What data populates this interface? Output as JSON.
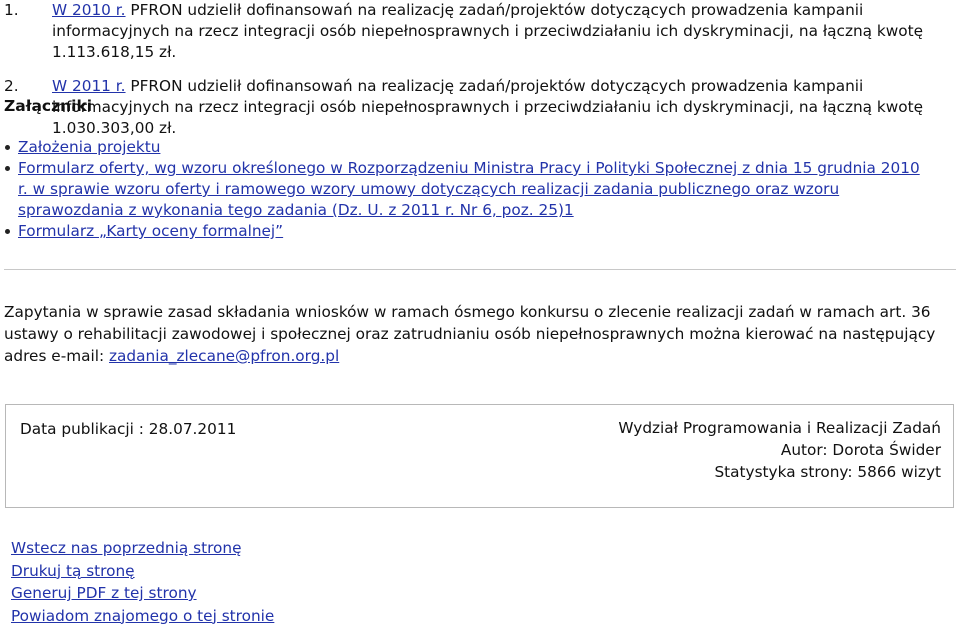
{
  "grants": [
    {
      "number": "1.",
      "year": "W 2010 r.",
      "text": "PFRON udzielił dofinansowań na realizację zadań/projektów dotyczących prowadzenia kampanii informacyjnych na rzecz integracji osób niepełnosprawnych i przeciwdziałaniu ich dyskryminacji, na łączną kwotę 1.113.618,15 zł."
    },
    {
      "number": "2.",
      "year": "W 2011 r.",
      "text": "PFRON udzielił dofinansowań na realizację zadań/projektów dotyczących prowadzenia kampanii informacyjnych na rzecz integracji osób niepełnosprawnych i przeciwdziałaniu ich dyskryminacji, na łączną kwotę 1.030.303,00 zł."
    }
  ],
  "attachments_heading": "Załączniki",
  "attachments": [
    "Założenia projektu",
    "Formularz oferty, wg wzoru określonego w Rozporządzeniu Ministra Pracy i Polityki Społecznej z dnia 15 grudnia 2010 r. w sprawie wzoru oferty i ramowego wzory umowy dotyczących realizacji zadania publicznego oraz wzoru sprawozdania z wykonania tego zadania (Dz. U. z 2011 r. Nr 6, poz. 25)1",
    "Formularz „Karty oceny formalnej”"
  ],
  "inquiry": {
    "text": "Zapytania w sprawie zasad składania wniosków w ramach ósmego  konkursu o zlecenie realizacji zadań w ramach art. 36 ustawy o rehabilitacji zawodowej i społecznej oraz zatrudnianiu osób niepełnosprawnych można kierować na następujący adres e-mail: ",
    "email": "zadania_zlecane@pfron.org.pl"
  },
  "info": {
    "publication_date": "Data publikacji : 28.07.2011",
    "department": "Wydział Programowania i Realizacji Zadań",
    "author": "Autor: Dorota Świder",
    "stats": "Statystyka strony: 5866 wizyt"
  },
  "footer_links": [
    "Wstecz nas poprzednią stronę",
    "Drukuj tą stronę",
    "Generuj PDF z tej strony",
    "Powiadom znajomego o tej stronie"
  ],
  "colors": {
    "link": "#2233aa",
    "text": "#111111",
    "border": "#b8b8b8"
  }
}
